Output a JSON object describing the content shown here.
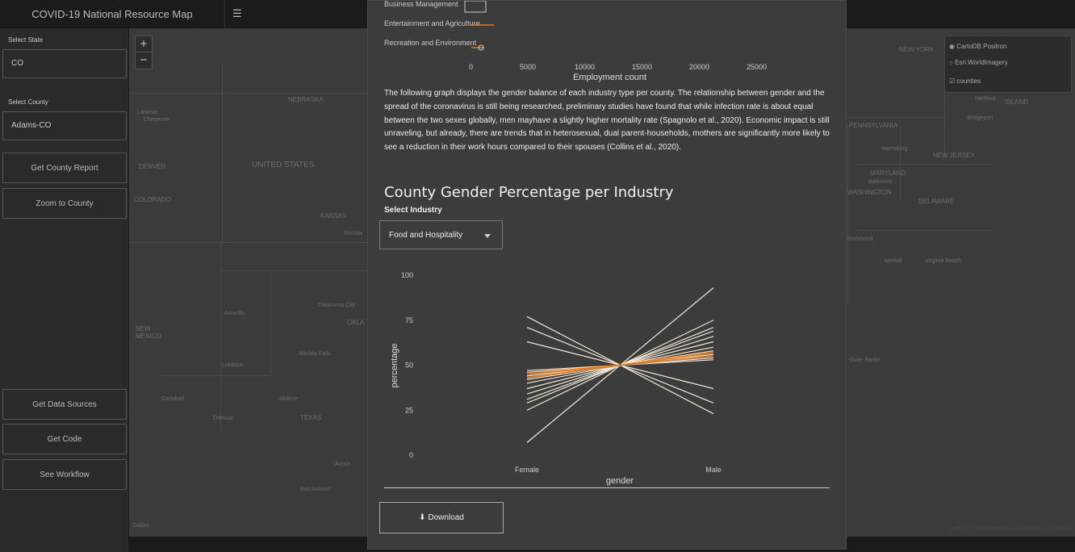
{
  "app": {
    "title": "COVID-19 National Resource Map"
  },
  "sidebar": {
    "state_label": "Select State",
    "state_value": "CO",
    "county_label": "Select County",
    "county_value": "Adams-CO",
    "buttons": {
      "county_report": "Get County Report",
      "zoom_county": "Zoom to County",
      "data_sources": "Get Data Sources",
      "get_code": "Get Code",
      "workflow": "See Workflow"
    }
  },
  "map": {
    "zoom_in": "+",
    "zoom_out": "−",
    "layers": [
      {
        "label": "CartoDB.Positron",
        "type": "radio",
        "checked": true
      },
      {
        "label": "Esri.WorldImagery",
        "type": "radio",
        "checked": false
      },
      {
        "label": "counties",
        "type": "checkbox",
        "checked": true
      }
    ],
    "places": [
      "NEBRASKA",
      "UNITED STATES",
      "KANSAS",
      "DENVER",
      "COLORADO",
      "NEW MEXICO",
      "OKLA",
      "TEXAS",
      "Oklahoma City",
      "Amarillo",
      "Wichita Falls",
      "Lubbock",
      "Abilene",
      "Odessa",
      "Carlsbad",
      "Austin",
      "San Antonio",
      "Dallas",
      "Laramie",
      "Cheyenne",
      "Wichita",
      "NEW YORK",
      "PENNSYLVANIA",
      "NEW JERSEY",
      "MARYLAND",
      "DELAWARE",
      "Hartford",
      "ISLAND",
      "Bridgeport",
      "Harrisburg",
      "Baltimore",
      "WASHINGTON",
      "Richmond",
      "Norfolk",
      "Virginia Beach",
      "Outer Banks",
      "NEW YORK"
    ],
    "attribution": "Leaflet | © OpenStreetMap contributors © CARTO"
  },
  "modal": {
    "top_chart": {
      "categories": [
        "Business Management",
        "Entertainment and Agriculture",
        "Recreation and Environment"
      ],
      "ticks": [
        "0",
        "5000",
        "10000",
        "15000",
        "20000",
        "25000"
      ],
      "xlabel": "Employment count"
    },
    "paragraph": "The following graph displays the gender balance of each industry type per county. The relationship between gender and the spread of the coronavirus is still being researched, preliminary studies have found that while infection rate is about equal between the two sexes globally, men mayhave a slightly higher mortality rate (Spagnolo et al., 2020). Economic impact is still unraveling, but already, there are trends that in heterosexual, dual parent-households, mothers are significantly more likely to see a reduction in their work hours compared to their spouses (Collins et al., 2020).",
    "section_title": "County Gender Percentage per Industry",
    "select_label": "Select Industry",
    "select_value": "Food and Hospitality",
    "download_label": "Download"
  },
  "chart_data": {
    "type": "line",
    "xlabel": "gender",
    "ylabel": "percentage",
    "categories": [
      "Female",
      "Male"
    ],
    "ylim": [
      0,
      100
    ],
    "yticks": [
      0,
      25,
      50,
      75,
      100
    ],
    "highlight_color": "#e07b22",
    "line_color": "#f3e7d6",
    "series": [
      {
        "values": [
          7,
          93
        ],
        "highlight": false
      },
      {
        "values": [
          25,
          75
        ],
        "highlight": false
      },
      {
        "values": [
          29,
          71
        ],
        "highlight": false
      },
      {
        "values": [
          31,
          69
        ],
        "highlight": false
      },
      {
        "values": [
          34,
          66
        ],
        "highlight": false
      },
      {
        "values": [
          37,
          63
        ],
        "highlight": false
      },
      {
        "values": [
          40,
          60
        ],
        "highlight": false
      },
      {
        "values": [
          42,
          58
        ],
        "highlight": false
      },
      {
        "values": [
          44,
          56
        ],
        "highlight": false
      },
      {
        "values": [
          46,
          54
        ],
        "highlight": false
      },
      {
        "values": [
          47,
          53
        ],
        "highlight": false
      },
      {
        "values": [
          63,
          37
        ],
        "highlight": false
      },
      {
        "values": [
          71,
          29
        ],
        "highlight": false
      },
      {
        "values": [
          77,
          23
        ],
        "highlight": false
      },
      {
        "values": [
          43,
          57
        ],
        "highlight": true
      },
      {
        "values": [
          45,
          55
        ],
        "highlight": true
      }
    ]
  }
}
